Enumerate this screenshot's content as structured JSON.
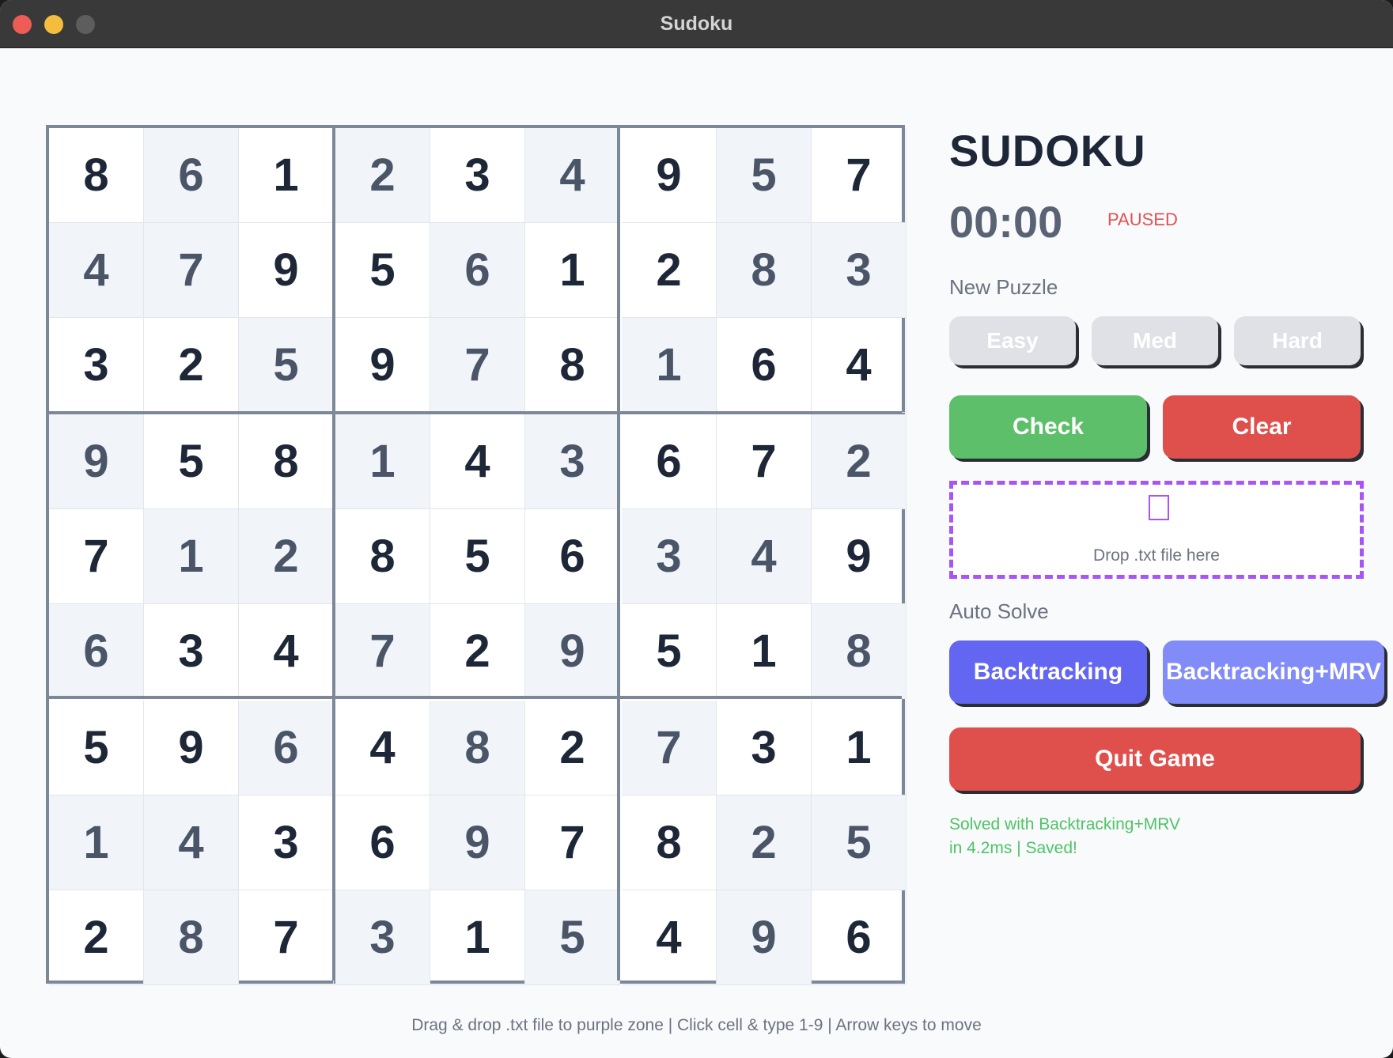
{
  "window": {
    "title": "Sudoku"
  },
  "board": {
    "rows": [
      [
        8,
        6,
        1,
        2,
        3,
        4,
        9,
        5,
        7
      ],
      [
        4,
        7,
        9,
        5,
        6,
        1,
        2,
        8,
        3
      ],
      [
        3,
        2,
        5,
        9,
        7,
        8,
        1,
        6,
        4
      ],
      [
        9,
        5,
        8,
        1,
        4,
        3,
        6,
        7,
        2
      ],
      [
        7,
        1,
        2,
        8,
        5,
        6,
        3,
        4,
        9
      ],
      [
        6,
        3,
        4,
        7,
        2,
        9,
        5,
        1,
        8
      ],
      [
        5,
        9,
        6,
        4,
        8,
        2,
        7,
        3,
        1
      ],
      [
        1,
        4,
        3,
        6,
        9,
        7,
        8,
        2,
        5
      ],
      [
        2,
        8,
        7,
        3,
        1,
        5,
        4,
        9,
        6
      ]
    ],
    "given": [
      [
        0,
        1,
        0,
        1,
        0,
        1,
        0,
        1,
        0
      ],
      [
        1,
        1,
        0,
        0,
        1,
        0,
        0,
        1,
        1
      ],
      [
        0,
        0,
        1,
        0,
        1,
        0,
        1,
        0,
        0
      ],
      [
        1,
        0,
        0,
        1,
        0,
        1,
        0,
        0,
        1
      ],
      [
        0,
        1,
        1,
        0,
        0,
        0,
        1,
        1,
        0
      ],
      [
        1,
        0,
        0,
        1,
        0,
        1,
        0,
        0,
        1
      ],
      [
        0,
        0,
        1,
        0,
        1,
        0,
        1,
        0,
        0
      ],
      [
        1,
        1,
        0,
        0,
        1,
        0,
        0,
        1,
        1
      ],
      [
        0,
        1,
        0,
        1,
        0,
        1,
        0,
        1,
        0
      ]
    ]
  },
  "panel": {
    "title": "SUDOKU",
    "timer": "00:00",
    "timer_state": "PAUSED",
    "new_puzzle_label": "New Puzzle",
    "difficulty": {
      "easy": "Easy",
      "medium": "Med",
      "hard": "Hard"
    },
    "check_label": "Check",
    "clear_label": "Clear",
    "drop_text": "Drop .txt file here",
    "auto_solve_label": "Auto Solve",
    "backtracking_label": "Backtracking",
    "backtracking_mrv_label": "Backtracking+MRV",
    "quit_label": "Quit Game",
    "status_line1": "Solved with Backtracking+MRV",
    "status_line2": "in 4.2ms | Saved!"
  },
  "footer": "Drag & drop .txt file to purple zone | Click cell & type 1-9 | Arrow keys to move",
  "colors": {
    "title_bar": "#393939",
    "board_border": "#7c8797",
    "given_cell_bg": "#f1f4f8",
    "check_button": "#5dbf69",
    "clear_button": "#df504d",
    "dropzone_border": "#a855f7",
    "backtracking_button": "#6366f1",
    "backtracking_mrv_button": "#818cf8",
    "quit_button": "#df504d",
    "status_text": "#4fc365",
    "paused_text": "#e15252"
  }
}
